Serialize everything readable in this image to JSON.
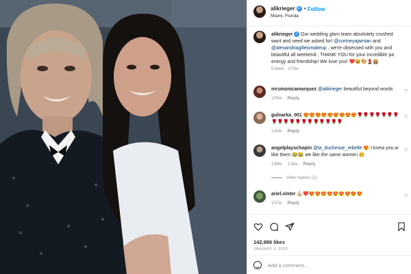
{
  "post": {
    "author": "alikrieger",
    "location": "Miami, Florida",
    "follow_label": "Follow",
    "separator": "•"
  },
  "caption": {
    "username": "alikrieger",
    "line1": "Our wedding glam team absolutely crushed",
    "line2": "want and need we asked for!",
    "mention1": "@cortneyajamian",
    "mention2": "@alexandriagilleomakeup",
    "line3": ", we're obsessed with you and",
    "line4": "beautiful all weekend.. THANK YOU for your incredible pa",
    "line5": "energy and friendship! We love you!",
    "line5_emojis": "❤️😆🎨💄👸🏽",
    "meta_edited": "Edited",
    "meta_time": "173w"
  },
  "comments": [
    {
      "username": "mrsmonicamarquez",
      "mention": "@alikrieger",
      "text": "beautiful beyond words",
      "time": "109w",
      "reply": "Reply"
    },
    {
      "username": "gulnarka_001",
      "text": "😍😍😍😍😍😍😍😍😍🌹🌹🌹🌹🌹🌹🌹",
      "text2": "🌹🌹🌹🌹🌹🌹🌹🌹🌹🌹🌹🌹",
      "time": "130w",
      "reply": "Reply"
    },
    {
      "username": "angelplayschopin",
      "mention": "@la_duchesse_rebelle",
      "text": "😍 I knew you w",
      "text2": "like them 😂😂 we like the same women 🥴",
      "time": "136w",
      "likes": "1 like",
      "reply": "Reply",
      "view_replies": "View replies (2)"
    },
    {
      "username": "ariel.vinter",
      "text": "💪🏼❤️😍😍😍😍😍😍😍😍😍",
      "time": "137w",
      "reply": "Reply"
    }
  ],
  "actions": {
    "likes": "142,986 likes",
    "date": "JANUARY 3, 2020"
  },
  "composer": {
    "placeholder": "Add a comment..."
  },
  "colors": {
    "link": "#00376b",
    "accent": "#0095f6",
    "verified": "#3897f0",
    "muted": "#8e8e8e"
  }
}
